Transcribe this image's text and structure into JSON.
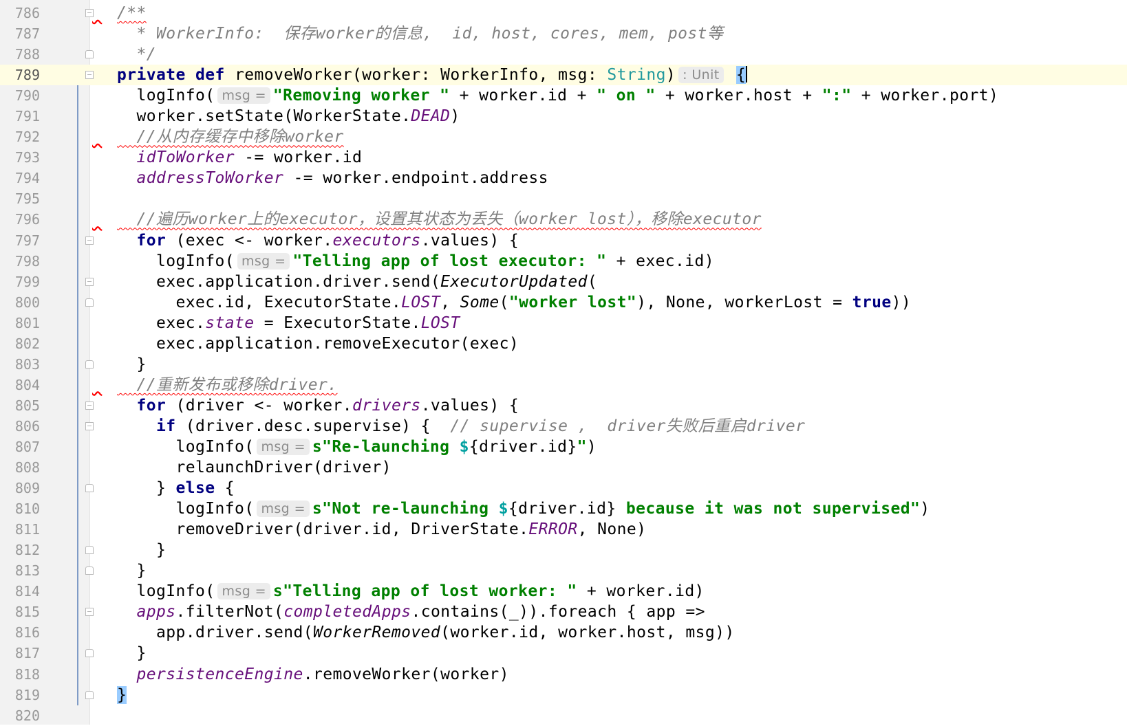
{
  "editor": {
    "language": "Scala",
    "current_line": 789
  },
  "lines": [
    {
      "n": "786",
      "fold": "start",
      "tokens": [
        [
          "doc",
          "/**"
        ]
      ],
      "squiggle": true
    },
    {
      "n": "787",
      "fold": "",
      "tokens": [
        [
          "doc",
          "  * WorkerInfo:  保存worker的信息,  id, host, cores, mem, post等"
        ]
      ]
    },
    {
      "n": "788",
      "fold": "end",
      "tokens": [
        [
          "doc",
          "  */"
        ]
      ]
    },
    {
      "n": "789",
      "fold": "start",
      "tokens": [
        [
          "kw",
          "private def "
        ],
        [
          "plain",
          "removeWorker(worker: WorkerInfo, msg: "
        ],
        [
          "type-str",
          "String"
        ],
        [
          "plain",
          ")"
        ],
        [
          "hint",
          ": Unit"
        ],
        [
          "plain",
          " "
        ],
        [
          "brace-hl",
          "{"
        ]
      ]
    },
    {
      "n": "790",
      "fold": "",
      "tokens": [
        [
          "plain",
          "  logInfo("
        ],
        [
          "hint",
          "msg ="
        ],
        [
          "str",
          "\"Removing worker \""
        ],
        [
          "plain",
          " + worker.id + "
        ],
        [
          "str",
          "\" on \""
        ],
        [
          "plain",
          " + worker.host + "
        ],
        [
          "str",
          "\":\""
        ],
        [
          "plain",
          " + worker.port)"
        ]
      ]
    },
    {
      "n": "791",
      "fold": "",
      "tokens": [
        [
          "plain",
          "  worker.setState(WorkerState."
        ],
        [
          "field",
          "DEAD"
        ],
        [
          "plain",
          ")"
        ]
      ]
    },
    {
      "n": "792",
      "fold": "",
      "tokens": [
        [
          "comment",
          "  //从内存缓存中移除worker"
        ]
      ],
      "squiggle": true
    },
    {
      "n": "793",
      "fold": "",
      "tokens": [
        [
          "plain",
          "  "
        ],
        [
          "field",
          "idToWorker"
        ],
        [
          "plain",
          " -= worker.id"
        ]
      ]
    },
    {
      "n": "794",
      "fold": "",
      "tokens": [
        [
          "plain",
          "  "
        ],
        [
          "field",
          "addressToWorker"
        ],
        [
          "plain",
          " -= worker.endpoint.address"
        ]
      ]
    },
    {
      "n": "795",
      "fold": "",
      "tokens": []
    },
    {
      "n": "796",
      "fold": "",
      "tokens": [
        [
          "comment",
          "  //遍历worker上的executor，设置其状态为丢失（worker lost），移除executor"
        ]
      ],
      "squiggle": true
    },
    {
      "n": "797",
      "fold": "start",
      "tokens": [
        [
          "plain",
          "  "
        ],
        [
          "kw",
          "for"
        ],
        [
          "plain",
          " (exec <- worker."
        ],
        [
          "field",
          "executors"
        ],
        [
          "plain",
          ".values) {"
        ]
      ]
    },
    {
      "n": "798",
      "fold": "",
      "tokens": [
        [
          "plain",
          "    logInfo("
        ],
        [
          "hint",
          "msg ="
        ],
        [
          "str",
          "\"Telling app of lost executor: \""
        ],
        [
          "plain",
          " + exec.id)"
        ]
      ]
    },
    {
      "n": "799",
      "fold": "start",
      "tokens": [
        [
          "plain",
          "    exec.application.driver.send("
        ],
        [
          "italic",
          "ExecutorUpdated"
        ],
        [
          "plain",
          "("
        ]
      ]
    },
    {
      "n": "800",
      "fold": "end",
      "tokens": [
        [
          "plain",
          "      exec.id, ExecutorState."
        ],
        [
          "field",
          "LOST"
        ],
        [
          "plain",
          ", "
        ],
        [
          "italic",
          "Some"
        ],
        [
          "plain",
          "("
        ],
        [
          "str",
          "\"worker lost\""
        ],
        [
          "plain",
          "), None, workerLost = "
        ],
        [
          "kw",
          "true"
        ],
        [
          "plain",
          "))"
        ]
      ]
    },
    {
      "n": "801",
      "fold": "",
      "tokens": [
        [
          "plain",
          "    exec."
        ],
        [
          "field",
          "state"
        ],
        [
          "plain",
          " = ExecutorState."
        ],
        [
          "field",
          "LOST"
        ]
      ]
    },
    {
      "n": "802",
      "fold": "",
      "tokens": [
        [
          "plain",
          "    exec.application.removeExecutor(exec)"
        ]
      ]
    },
    {
      "n": "803",
      "fold": "end",
      "tokens": [
        [
          "plain",
          "  }"
        ]
      ]
    },
    {
      "n": "804",
      "fold": "",
      "tokens": [
        [
          "comment",
          "  //重新发布或移除driver."
        ]
      ],
      "squiggle": true
    },
    {
      "n": "805",
      "fold": "start",
      "tokens": [
        [
          "plain",
          "  "
        ],
        [
          "kw",
          "for"
        ],
        [
          "plain",
          " (driver <- worker."
        ],
        [
          "field",
          "drivers"
        ],
        [
          "plain",
          ".values) {"
        ]
      ]
    },
    {
      "n": "806",
      "fold": "start",
      "tokens": [
        [
          "plain",
          "    "
        ],
        [
          "kw",
          "if"
        ],
        [
          "plain",
          " (driver.desc.supervise) {  "
        ],
        [
          "comment",
          "// supervise ,  driver失败后重启driver"
        ]
      ]
    },
    {
      "n": "807",
      "fold": "",
      "tokens": [
        [
          "plain",
          "      logInfo("
        ],
        [
          "hint",
          "msg ="
        ],
        [
          "str",
          "s\"Re-launching "
        ],
        [
          "dollar",
          "$"
        ],
        [
          "plain",
          "{driver.id}"
        ],
        [
          "str",
          "\""
        ],
        [
          "plain",
          ")"
        ]
      ]
    },
    {
      "n": "808",
      "fold": "",
      "tokens": [
        [
          "plain",
          "      relaunchDriver(driver)"
        ]
      ]
    },
    {
      "n": "809",
      "fold": "end",
      "tokens": [
        [
          "plain",
          "    } "
        ],
        [
          "kw",
          "else"
        ],
        [
          "plain",
          " {"
        ]
      ]
    },
    {
      "n": "810",
      "fold": "",
      "tokens": [
        [
          "plain",
          "      logInfo("
        ],
        [
          "hint",
          "msg ="
        ],
        [
          "str",
          "s\"Not re-launching "
        ],
        [
          "dollar",
          "$"
        ],
        [
          "plain",
          "{driver.id}"
        ],
        [
          "str",
          " because it was not supervised\""
        ],
        [
          "plain",
          ")"
        ]
      ]
    },
    {
      "n": "811",
      "fold": "",
      "tokens": [
        [
          "plain",
          "      removeDriver(driver.id, DriverState."
        ],
        [
          "field",
          "ERROR"
        ],
        [
          "plain",
          ", None)"
        ]
      ]
    },
    {
      "n": "812",
      "fold": "end",
      "tokens": [
        [
          "plain",
          "    }"
        ]
      ]
    },
    {
      "n": "813",
      "fold": "end",
      "tokens": [
        [
          "plain",
          "  }"
        ]
      ]
    },
    {
      "n": "814",
      "fold": "",
      "tokens": [
        [
          "plain",
          "  logInfo("
        ],
        [
          "hint",
          "msg ="
        ],
        [
          "str",
          "s\"Telling app of lost worker: \""
        ],
        [
          "plain",
          " + worker.id)"
        ]
      ]
    },
    {
      "n": "815",
      "fold": "start",
      "tokens": [
        [
          "plain",
          "  "
        ],
        [
          "field",
          "apps"
        ],
        [
          "plain",
          ".filterNot("
        ],
        [
          "field",
          "completedApps"
        ],
        [
          "plain",
          ".contains(_)).foreach { app =>"
        ]
      ]
    },
    {
      "n": "816",
      "fold": "",
      "tokens": [
        [
          "plain",
          "    app.driver.send("
        ],
        [
          "italic",
          "WorkerRemoved"
        ],
        [
          "plain",
          "(worker.id, worker.host, msg))"
        ]
      ]
    },
    {
      "n": "817",
      "fold": "end",
      "tokens": [
        [
          "plain",
          "  }"
        ]
      ]
    },
    {
      "n": "818",
      "fold": "",
      "tokens": [
        [
          "plain",
          "  "
        ],
        [
          "field",
          "persistenceEngine"
        ],
        [
          "plain",
          ".removeWorker(worker)"
        ]
      ]
    },
    {
      "n": "819",
      "fold": "end",
      "tokens": [
        [
          "brace-hl",
          "}"
        ]
      ]
    },
    {
      "n": "820",
      "fold": "",
      "tokens": []
    }
  ]
}
